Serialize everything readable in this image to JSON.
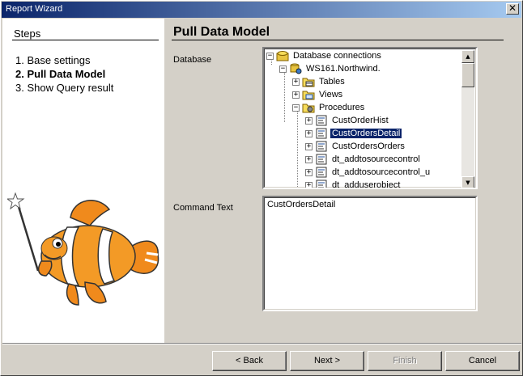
{
  "window": {
    "title": "Report Wizard",
    "close_glyph": "✕"
  },
  "steps": {
    "title": "Steps",
    "items": [
      {
        "label": "1. Base settings",
        "active": false
      },
      {
        "label": "2. Pull Data Model",
        "active": true
      },
      {
        "label": "3. Show Query result",
        "active": false
      }
    ]
  },
  "main": {
    "title": "Pull Data Model",
    "database_label": "Database",
    "command_label": "Command Text",
    "command_text": "CustOrdersDetail"
  },
  "tree": {
    "nodes": [
      {
        "label": "Database connections",
        "icon": "database-connections-icon",
        "expander": "−"
      },
      {
        "label": "WS161.Northwind.",
        "icon": "database-server-icon",
        "expander": "−"
      },
      {
        "label": "Tables",
        "icon": "tables-folder-icon",
        "expander": "+"
      },
      {
        "label": "Views",
        "icon": "views-folder-icon",
        "expander": "+"
      },
      {
        "label": "Procedures",
        "icon": "procedures-folder-icon",
        "expander": "−"
      },
      {
        "label": "CustOrderHist",
        "icon": "procedure-icon",
        "expander": "+"
      },
      {
        "label": "CustOrdersDetail",
        "icon": "procedure-icon",
        "expander": "+",
        "selected": true
      },
      {
        "label": "CustOrdersOrders",
        "icon": "procedure-icon",
        "expander": "+"
      },
      {
        "label": "dt_addtosourcecontrol",
        "icon": "procedure-icon",
        "expander": "+"
      },
      {
        "label": "dt_addtosourcecontrol_u",
        "icon": "procedure-icon",
        "expander": "+"
      },
      {
        "label": "dt_adduserobject",
        "icon": "procedure-icon",
        "expander": "+"
      }
    ]
  },
  "buttons": {
    "back": "< Back",
    "next": "Next >",
    "finish": "Finish",
    "cancel": "Cancel"
  },
  "scrollbar": {
    "up": "▲",
    "down": "▼"
  }
}
